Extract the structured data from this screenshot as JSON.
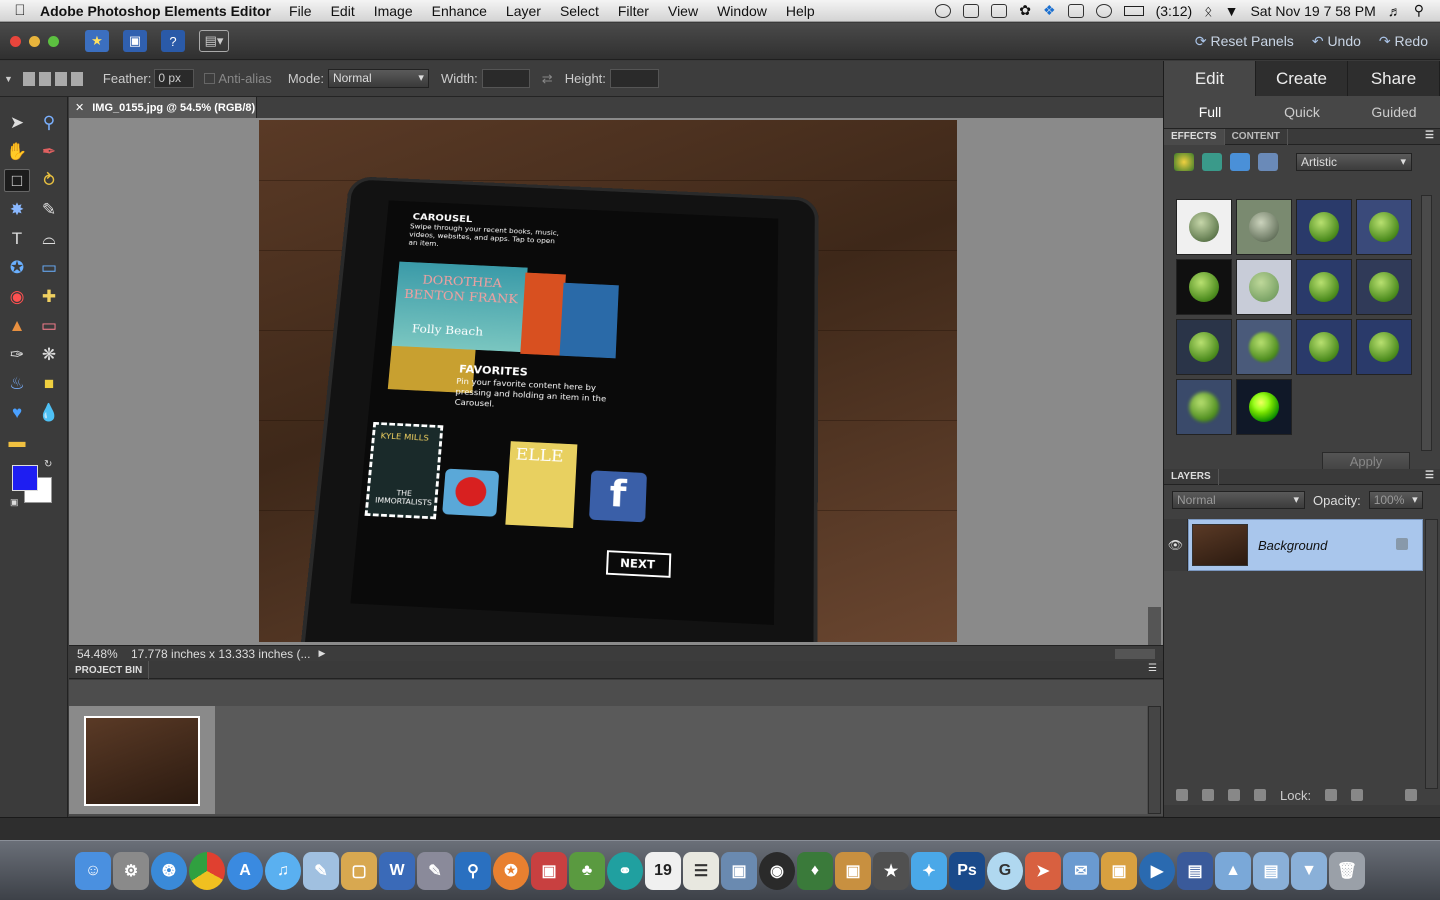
{
  "menubar": {
    "app_name": "Adobe Photoshop Elements Editor",
    "menus": [
      "File",
      "Edit",
      "Image",
      "Enhance",
      "Layer",
      "Select",
      "Filter",
      "View",
      "Window",
      "Help"
    ],
    "battery": "(3:12)",
    "clock": "Sat Nov 19  7 58 PM"
  },
  "toolbar": {
    "reset_panels": "Reset Panels",
    "undo": "Undo",
    "redo": "Redo"
  },
  "options": {
    "feather_label": "Feather:",
    "feather_value": "0 px",
    "antialias_label": "Anti-alias",
    "mode_label": "Mode:",
    "mode_value": "Normal",
    "width_label": "Width:",
    "height_label": "Height:"
  },
  "document": {
    "tab_title": "IMG_0155.jpg @ 54.5% (RGB/8)",
    "zoom": "54.48%",
    "dimensions": "17.778 inches x 13.333 inches (..."
  },
  "photo": {
    "carousel_title": "CAROUSEL",
    "carousel_desc": "Swipe through your recent books, music, videos, websites, and apps. Tap to open an item.",
    "book_title": "DOROTHEA BENTON FRANK",
    "book_sub": "Folly Beach",
    "favorites_title": "FAVORITES",
    "favorites_desc": "Pin your favorite content here by pressing and holding an item in the Carousel.",
    "kyle": "KYLE MILLS",
    "immortalists": "THE IMMORTALISTS",
    "elle": "ELLE",
    "next": "NEXT",
    "facebook": "f"
  },
  "project_bin": {
    "title": "PROJECT BIN"
  },
  "panel": {
    "modes": [
      "Edit",
      "Create",
      "Share"
    ],
    "submodes": [
      "Full",
      "Quick",
      "Guided"
    ],
    "effects_tab": "EFFECTS",
    "content_tab": "CONTENT",
    "effects_category": "Artistic",
    "apply": "Apply",
    "layers_title": "LAYERS",
    "blend_mode": "Normal",
    "opacity_label": "Opacity:",
    "opacity_value": "100%",
    "layer_name": "Background",
    "lock_label": "Lock:"
  },
  "colors": {
    "foreground": "#1e1ef2",
    "background": "#ffffff",
    "selected_layer": "#a9c6ec"
  }
}
